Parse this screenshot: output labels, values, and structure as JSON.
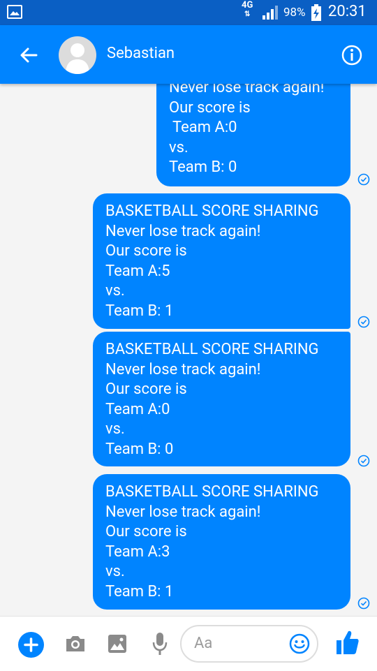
{
  "status": {
    "network": "4G",
    "battery": "98%",
    "time": "20:31"
  },
  "header": {
    "contact_name": "Sebastian"
  },
  "messages": [
    {
      "text": "Never lose track again!\nOur score is\n Team A:0\nvs.\nTeam B: 0"
    },
    {
      "text": "BASKETBALL SCORE SHARING\nNever lose track again!\nOur score is\nTeam A:5\nvs.\nTeam B: 1"
    },
    {
      "text": "BASKETBALL SCORE SHARING\nNever lose track again!\nOur score is\nTeam A:0\nvs.\nTeam B: 0"
    },
    {
      "text": "BASKETBALL SCORE SHARING\nNever lose track again!\nOur score is\nTeam A:3\nvs.\nTeam B: 1"
    }
  ],
  "composer": {
    "placeholder": "Aa"
  },
  "colors": {
    "accent": "#0084ff",
    "status_bar": "#0a5fc4"
  }
}
